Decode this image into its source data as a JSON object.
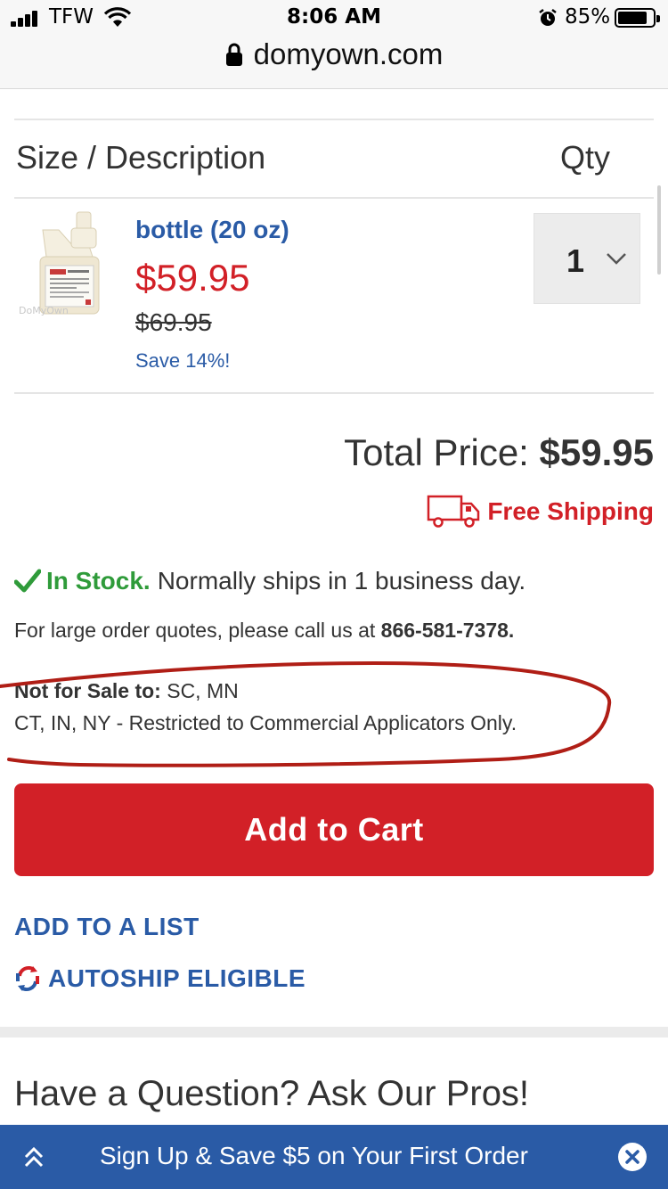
{
  "status_bar": {
    "carrier": "TFW",
    "time": "8:06 AM",
    "battery_pct": "85%"
  },
  "url_bar": {
    "domain": "domyown.com"
  },
  "table": {
    "col_size": "Size / Description",
    "col_qty": "Qty"
  },
  "product": {
    "name": "bottle (20 oz)",
    "price": "$59.95",
    "original_price": "$69.95",
    "savings": "Save 14%!",
    "image_watermark": "DoMyOwn",
    "quantity": "1"
  },
  "total": {
    "label": "Total Price:",
    "value": "$59.95"
  },
  "shipping": {
    "label": "Free Shipping"
  },
  "stock": {
    "status": "In Stock.",
    "note": "Normally ships in 1 business day."
  },
  "quote": {
    "text": "For large order quotes, please call us at",
    "phone": "866-581-7378."
  },
  "restrictions": {
    "not_for_sale_label": "Not for Sale to:",
    "not_for_sale_states": "SC, MN",
    "restricted_line": "CT, IN, NY - Restricted to Commercial Applicators Only."
  },
  "actions": {
    "add_to_cart": "Add to Cart",
    "add_to_list": "ADD TO A LIST",
    "autoship": "AUTOSHIP ELIGIBLE"
  },
  "question_heading": "Have a Question? Ask Our Pros!",
  "promo_bar": {
    "text": "Sign Up & Save $5 on Your First Order"
  },
  "colors": {
    "brand_blue": "#2a5ba6",
    "brand_red": "#d22027",
    "stock_green": "#2f9b3a",
    "annotation_red": "#b01e16"
  }
}
